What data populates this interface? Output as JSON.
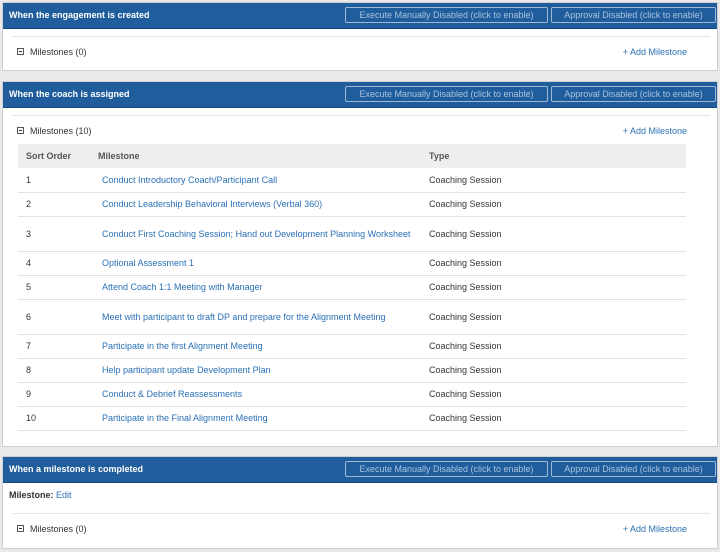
{
  "sections": [
    {
      "title": "When the engagement is created",
      "exec_btn": "Execute Manually Disabled (click to enable)",
      "appr_btn": "Approval Disabled (click to enable)",
      "milestones_label": "Milestones (0)",
      "add_link": "+ Add Milestone"
    },
    {
      "title": "When the coach is assigned",
      "exec_btn": "Execute Manually Disabled (click to enable)",
      "appr_btn": "Approval Disabled (click to enable)",
      "milestones_label": "Milestones (10)",
      "add_link": "+ Add Milestone",
      "table": {
        "headers": [
          "Sort Order",
          "Milestone",
          "Type"
        ],
        "rows": [
          {
            "order": "1",
            "milestone": "Conduct Introductory Coach/Participant Call",
            "type": "Coaching Session"
          },
          {
            "order": "2",
            "milestone": "Conduct Leadership Behavioral Interviews (Verbal 360)",
            "type": "Coaching Session"
          },
          {
            "order": "3",
            "milestone": "Conduct First Coaching Session; Hand out Development Planning Worksheet",
            "type": "Coaching Session"
          },
          {
            "order": "4",
            "milestone": "Optional Assessment 1",
            "type": "Coaching Session"
          },
          {
            "order": "5",
            "milestone": "Attend Coach 1:1 Meeting with Manager",
            "type": "Coaching Session"
          },
          {
            "order": "6",
            "milestone": "Meet with participant to draft DP and prepare for the Alignment Meeting",
            "type": "Coaching Session"
          },
          {
            "order": "7",
            "milestone": "Participate in the first Alignment Meeting",
            "type": "Coaching Session"
          },
          {
            "order": "8",
            "milestone": "Help participant update Development Plan",
            "type": "Coaching Session"
          },
          {
            "order": "9",
            "milestone": "Conduct & Debrief Reassessments",
            "type": "Coaching Session"
          },
          {
            "order": "10",
            "milestone": "Participate in the Final Alignment Meeting",
            "type": "Coaching Session"
          }
        ]
      }
    },
    {
      "title": "When a milestone is completed",
      "exec_btn": "Execute Manually Disabled (click to enable)",
      "appr_btn": "Approval Disabled (click to enable)",
      "milestone_prefix": "Milestone:",
      "milestone_edit": "Edit",
      "milestones_label": "Milestones (0)",
      "add_link": "+ Add Milestone"
    }
  ],
  "colors": {
    "header_bg": "#1f5d9c",
    "link": "#2a6fb5"
  }
}
